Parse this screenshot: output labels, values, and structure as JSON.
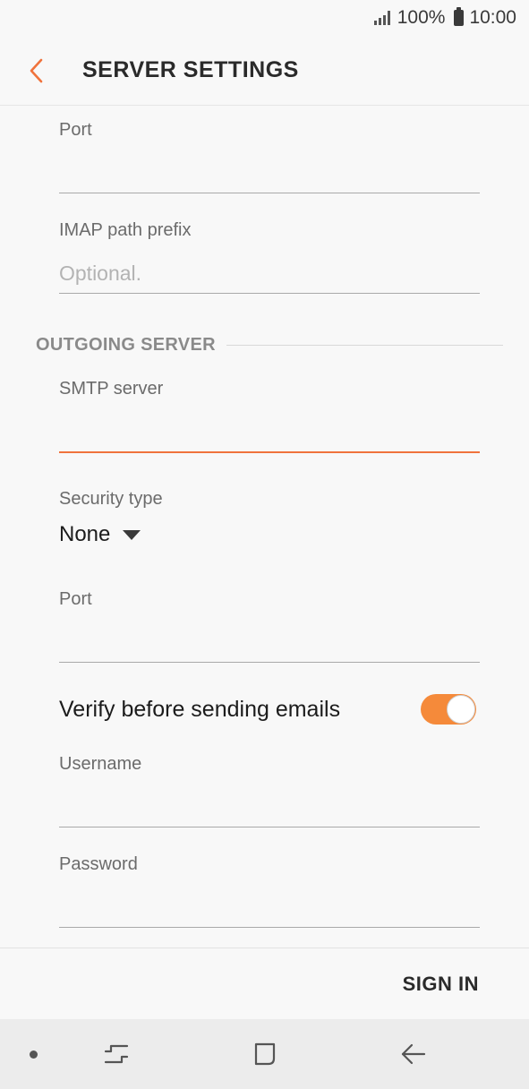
{
  "status_bar": {
    "battery_percent": "100%",
    "time": "10:00"
  },
  "header": {
    "title": "SERVER SETTINGS"
  },
  "incoming": {
    "port": {
      "label": "Port",
      "value": "",
      "placeholder": ""
    },
    "imap_prefix": {
      "label": "IMAP path prefix",
      "value": "",
      "placeholder": "Optional."
    }
  },
  "outgoing": {
    "section_title": "OUTGOING SERVER",
    "smtp_server": {
      "label": "SMTP server",
      "value": ""
    },
    "security_type": {
      "label": "Security type",
      "value": "None"
    },
    "port": {
      "label": "Port",
      "value": ""
    },
    "verify": {
      "label": "Verify before sending emails",
      "enabled": true
    },
    "username": {
      "label": "Username",
      "value": ""
    },
    "password": {
      "label": "Password",
      "value": ""
    }
  },
  "actions": {
    "sign_in": "SIGN IN"
  },
  "colors": {
    "accent": "#f0733c",
    "toggle_on": "#f58a3a"
  }
}
